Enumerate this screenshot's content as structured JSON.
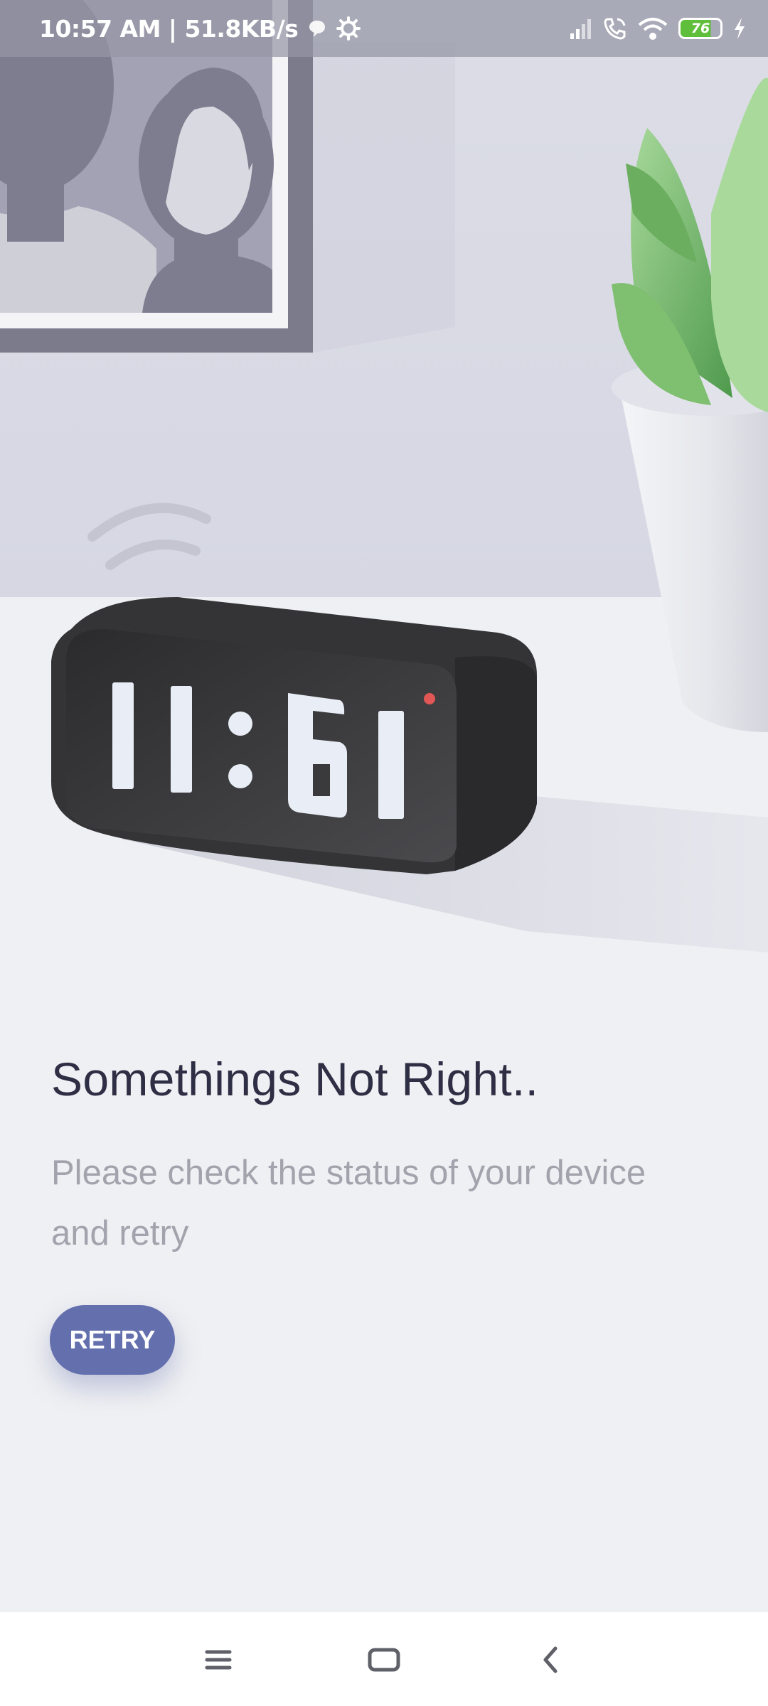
{
  "status_bar": {
    "time_speed": "10:57 AM | 51.8KB/s",
    "battery_level": "76",
    "icons": [
      "chat-bubble-icon",
      "settings-gear-icon",
      "signal-icon",
      "wifi-calling-icon",
      "wifi-icon",
      "battery-icon",
      "charging-bolt-icon"
    ]
  },
  "illustration": {
    "clock_display": "11:61"
  },
  "error": {
    "title": "Somethings Not Right..",
    "message": "Please check the status of your device and retry"
  },
  "actions": {
    "retry_label": "RETRY"
  },
  "nav_bar": {
    "icons": [
      "menu-icon",
      "home-icon",
      "back-icon"
    ]
  },
  "colors": {
    "accent": "#6470ad",
    "title": "#2e2e44",
    "message": "#a3a3ad",
    "background": "#eff0f3"
  }
}
